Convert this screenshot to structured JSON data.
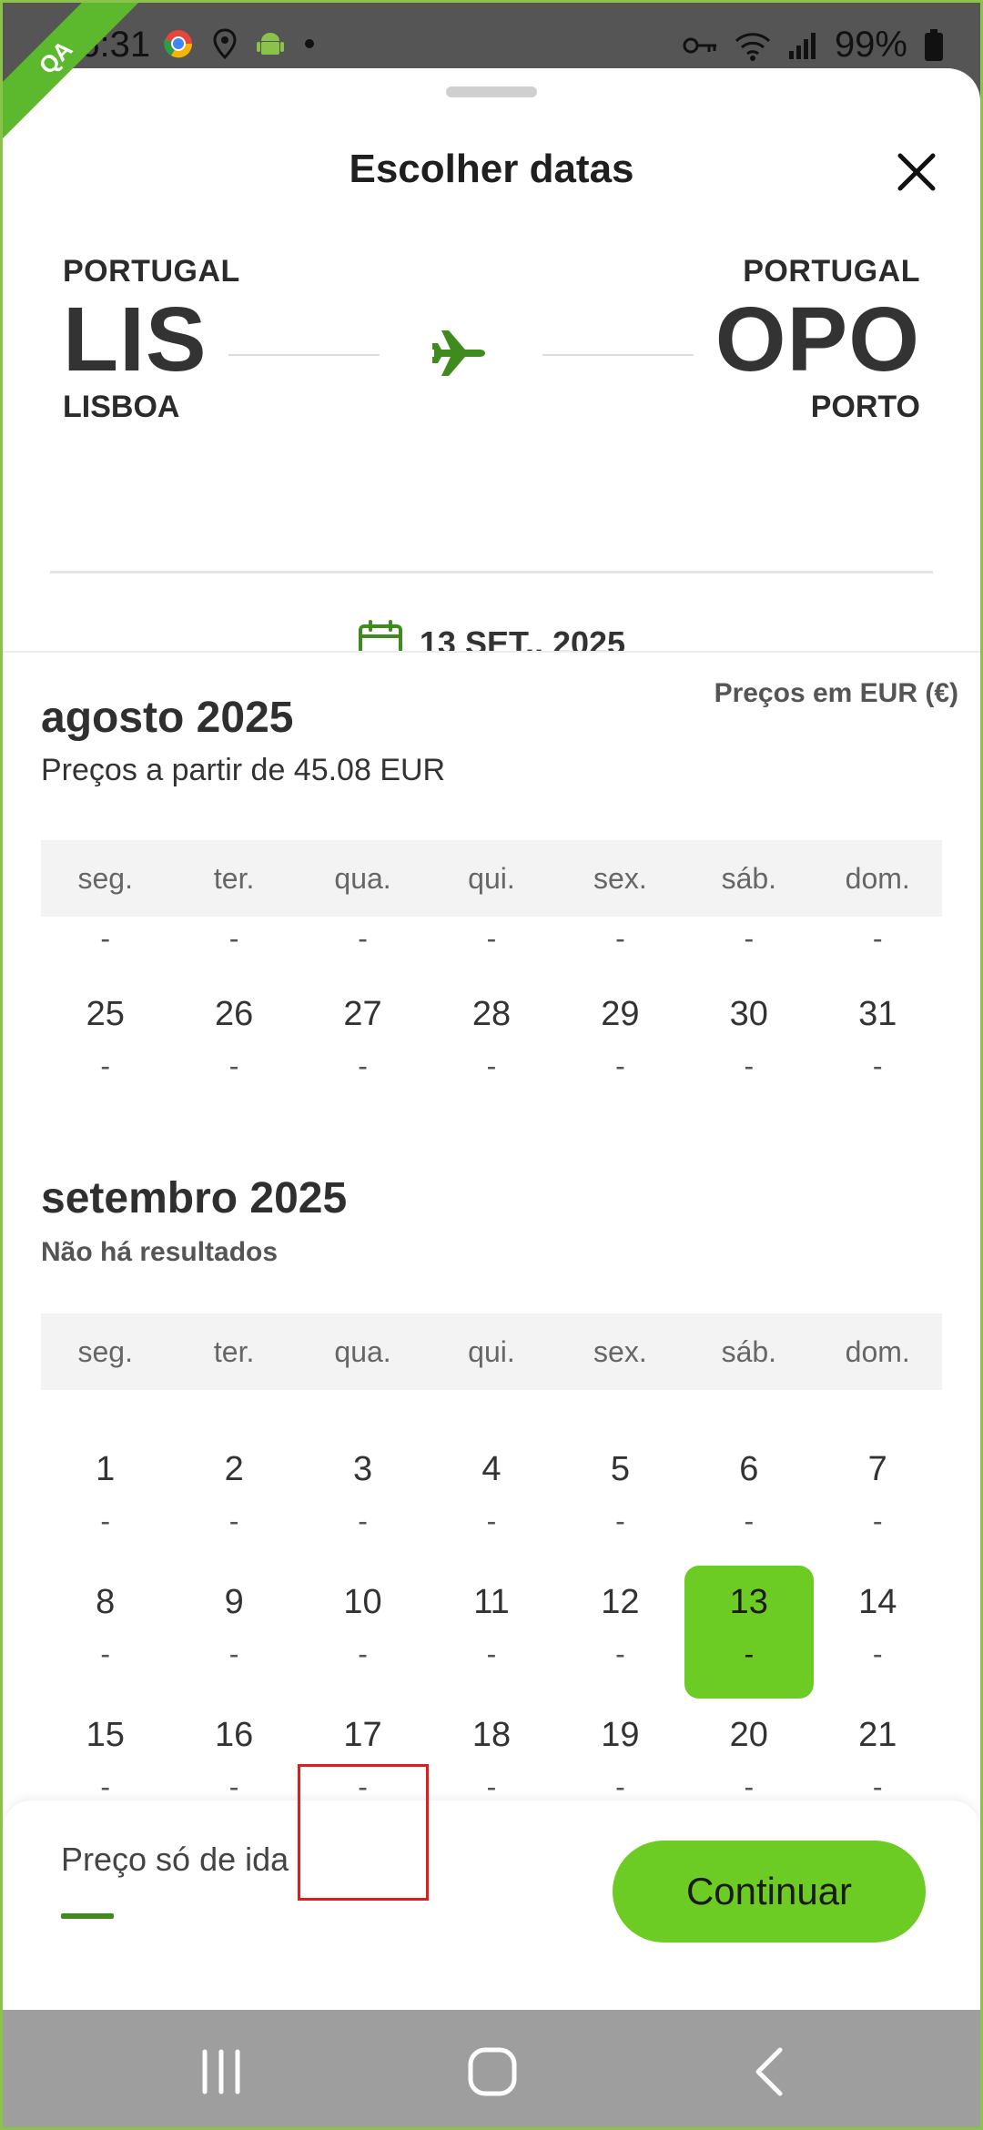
{
  "status_bar": {
    "time": "16:31",
    "battery": "99%"
  },
  "qa_badge": "QA",
  "sheet": {
    "title": "Escolher datas",
    "origin": {
      "country": "PORTUGAL",
      "code": "LIS",
      "city": "LISBOA"
    },
    "destination": {
      "country": "PORTUGAL",
      "code": "OPO",
      "city": "PORTO"
    },
    "selected_date": "13 SET., 2025",
    "currency_note": "Preços em EUR (€)"
  },
  "weekdays": [
    "seg.",
    "ter.",
    "qua.",
    "qui.",
    "sex.",
    "sáb.",
    "dom."
  ],
  "months": [
    {
      "title": "agosto 2025",
      "subtitle": "Preços a partir de 45.08 EUR",
      "rows": [
        {
          "days": [
            "25",
            "26",
            "27",
            "28",
            "29",
            "30",
            "31"
          ],
          "prices": [
            "-",
            "-",
            "-",
            "-",
            "-",
            "-",
            "-"
          ]
        }
      ]
    },
    {
      "title": "setembro 2025",
      "subtitle": "Não há resultados",
      "rows": [
        {
          "days": [
            "1",
            "2",
            "3",
            "4",
            "5",
            "6",
            "7"
          ],
          "prices": [
            "-",
            "-",
            "-",
            "-",
            "-",
            "-",
            "-"
          ]
        },
        {
          "days": [
            "8",
            "9",
            "10",
            "11",
            "12",
            "13",
            "14"
          ],
          "prices": [
            "-",
            "-",
            "-",
            "-",
            "-",
            "-",
            "-"
          ]
        },
        {
          "days": [
            "15",
            "16",
            "17",
            "18",
            "19",
            "20",
            "21"
          ],
          "prices": [
            "-",
            "-",
            "-",
            "-",
            "-",
            "-",
            "-"
          ]
        }
      ]
    }
  ],
  "bottom": {
    "price_mode": "Preço só de ida",
    "continue_label": "Continuar"
  },
  "colors": {
    "accent": "#6ccc23",
    "accent_dark": "#3f8b1e",
    "highlight": "#e31b1b"
  }
}
